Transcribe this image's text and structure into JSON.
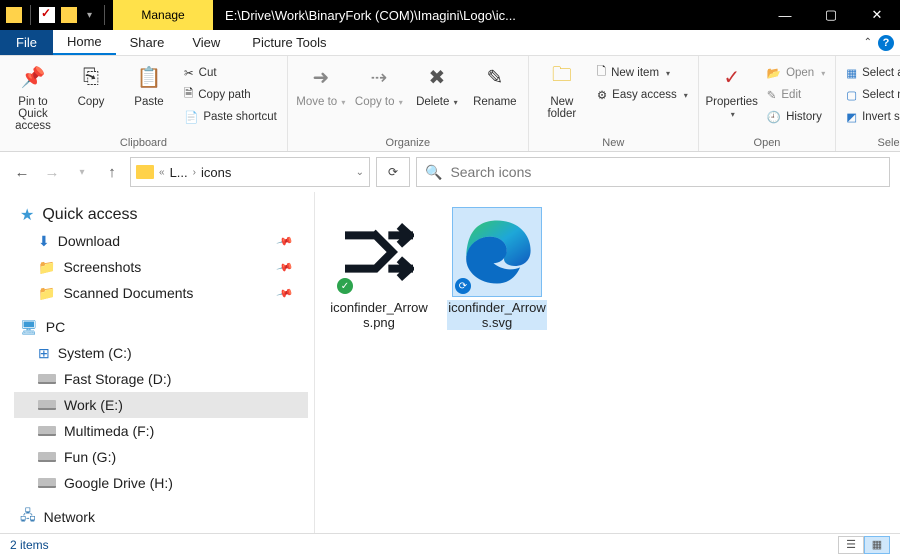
{
  "titlebar": {
    "manage_top": "Manage",
    "title": "E:\\Drive\\Work\\BinaryFork (COM)\\Imagini\\Logo\\ic..."
  },
  "menu": {
    "file": "File",
    "tabs": [
      "Home",
      "Share",
      "View"
    ],
    "tool_tab": "Picture Tools"
  },
  "ribbon": {
    "clipboard": {
      "label": "Clipboard",
      "pin": "Pin to Quick access",
      "copy": "Copy",
      "paste": "Paste",
      "cut": "Cut",
      "copy_path": "Copy path",
      "paste_shortcut": "Paste shortcut"
    },
    "organize": {
      "label": "Organize",
      "move_to": "Move to",
      "copy_to": "Copy to",
      "delete": "Delete",
      "rename": "Rename"
    },
    "new": {
      "label": "New",
      "new_folder": "New folder",
      "new_item": "New item",
      "easy_access": "Easy access"
    },
    "open": {
      "label": "Open",
      "properties": "Properties",
      "open": "Open",
      "edit": "Edit",
      "history": "History"
    },
    "select": {
      "label": "Select",
      "select_all": "Select all",
      "select_none": "Select none",
      "invert": "Invert selection"
    }
  },
  "nav": {
    "crumb1": "L...",
    "crumb2": "icons",
    "search_placeholder": "Search icons"
  },
  "sidebar": {
    "quick_access": "Quick access",
    "items_pinned": [
      "Download",
      "Screenshots",
      "Scanned Documents"
    ],
    "pc": "PC",
    "drives": [
      "System (C:)",
      "Fast Storage (D:)",
      "Work (E:)",
      "Multimeda (F:)",
      "Fun (G:)",
      "Google Drive (H:)"
    ],
    "network": "Network"
  },
  "files": [
    {
      "name": "iconfinder_Arrows.png",
      "selected": false,
      "badge_color": "#2da44e",
      "badge_glyph": "✓"
    },
    {
      "name": "iconfinder_Arrows.svg",
      "selected": true,
      "badge_color": "#0b74d1",
      "badge_glyph": "⟳"
    }
  ],
  "status": {
    "text": "2 items"
  }
}
